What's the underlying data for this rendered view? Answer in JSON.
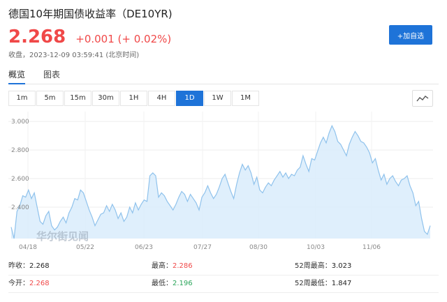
{
  "header": {
    "title": "德国10年期国债收益率（DE10YR)",
    "price": "2.268",
    "change": "+0.001 (+ 0.02%)",
    "close_info": "收盘，2023-12-09 03:59:41 (北京时间)",
    "add_label": "+加自选"
  },
  "tabs": [
    {
      "label": "概览",
      "active": true
    },
    {
      "label": "图表",
      "active": false
    }
  ],
  "ranges": [
    {
      "label": "1m",
      "active": false
    },
    {
      "label": "5m",
      "active": false
    },
    {
      "label": "15m",
      "active": false
    },
    {
      "label": "30m",
      "active": false
    },
    {
      "label": "1H",
      "active": false
    },
    {
      "label": "4H",
      "active": false
    },
    {
      "label": "1D",
      "active": true
    },
    {
      "label": "1W",
      "active": false
    },
    {
      "label": "1M",
      "active": false
    }
  ],
  "icons": {
    "chart_toggle": "line-chart-icon"
  },
  "colors": {
    "accent": "#1e73d8",
    "up": "#f04848",
    "down": "#2aa55a",
    "area": "#d9ecfb",
    "line": "#8fc2ec"
  },
  "watermark": "华尔街见闻",
  "chart_data": {
    "type": "area",
    "title": "",
    "xlabel": "",
    "ylabel": "",
    "y_ticks": [
      "3.000",
      "2.800",
      "2.600",
      "2.400"
    ],
    "y_tick_values": [
      3.0,
      2.8,
      2.6,
      2.4
    ],
    "x_ticks": [
      "04/18",
      "05/22",
      "06/23",
      "07/27",
      "08/30",
      "10/03",
      "11/06"
    ],
    "ylim": [
      2.18,
      3.04
    ],
    "grid": true,
    "values": [
      2.26,
      2.18,
      2.37,
      2.41,
      2.48,
      2.47,
      2.52,
      2.46,
      2.5,
      2.4,
      2.3,
      2.28,
      2.34,
      2.37,
      2.27,
      2.24,
      2.26,
      2.3,
      2.33,
      2.29,
      2.36,
      2.4,
      2.46,
      2.45,
      2.52,
      2.5,
      2.44,
      2.38,
      2.33,
      2.27,
      2.31,
      2.35,
      2.36,
      2.41,
      2.37,
      2.42,
      2.38,
      2.32,
      2.36,
      2.3,
      2.33,
      2.4,
      2.36,
      2.43,
      2.38,
      2.42,
      2.45,
      2.44,
      2.62,
      2.64,
      2.62,
      2.47,
      2.5,
      2.48,
      2.44,
      2.41,
      2.38,
      2.42,
      2.47,
      2.51,
      2.49,
      2.44,
      2.49,
      2.46,
      2.43,
      2.38,
      2.47,
      2.5,
      2.55,
      2.5,
      2.46,
      2.49,
      2.54,
      2.6,
      2.63,
      2.57,
      2.51,
      2.46,
      2.56,
      2.64,
      2.7,
      2.66,
      2.69,
      2.64,
      2.56,
      2.61,
      2.52,
      2.5,
      2.54,
      2.57,
      2.55,
      2.59,
      2.62,
      2.65,
      2.61,
      2.64,
      2.6,
      2.63,
      2.62,
      2.66,
      2.68,
      2.76,
      2.7,
      2.65,
      2.74,
      2.73,
      2.79,
      2.85,
      2.89,
      2.85,
      2.92,
      2.97,
      2.93,
      2.86,
      2.84,
      2.8,
      2.76,
      2.84,
      2.89,
      2.93,
      2.9,
      2.86,
      2.85,
      2.82,
      2.78,
      2.71,
      2.74,
      2.66,
      2.59,
      2.63,
      2.56,
      2.6,
      2.62,
      2.58,
      2.55,
      2.59,
      2.6,
      2.62,
      2.55,
      2.5,
      2.41,
      2.44,
      2.32,
      2.23,
      2.21,
      2.27
    ]
  },
  "stats": [
    [
      {
        "label": "昨收：",
        "value": "2.268",
        "color": "dark"
      },
      {
        "label": "最高：",
        "value": "2.286",
        "color": "red"
      },
      {
        "label": "52周最高：",
        "value": "3.023",
        "color": "dark"
      }
    ],
    [
      {
        "label": "今开：",
        "value": "2.268",
        "color": "red"
      },
      {
        "label": "最低：",
        "value": "2.196",
        "color": "green"
      },
      {
        "label": "52周最低：",
        "value": "1.847",
        "color": "dark"
      }
    ]
  ]
}
